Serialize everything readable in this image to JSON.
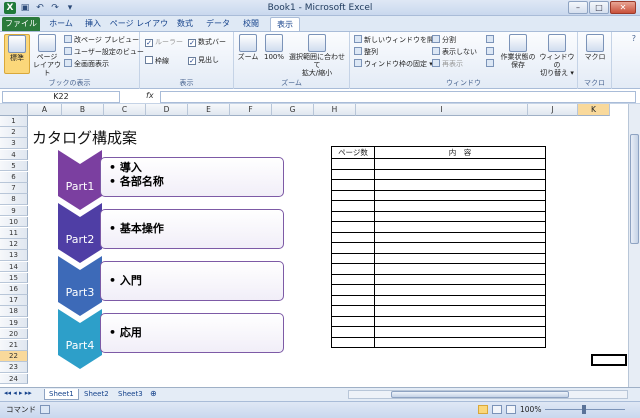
{
  "window": {
    "title": "Book1 - Microsoft Excel"
  },
  "tabs": [
    "ファイル",
    "ホーム",
    "挿入",
    "ページ レイアウト",
    "数式",
    "データ",
    "校閲",
    "表示"
  ],
  "ribbon": {
    "workbook_views": {
      "normal": "標準",
      "page_layout": "ページ\nレイアウト",
      "page_break": "改ページ プレビュー",
      "custom_views": "ユーザー設定のビュー",
      "full_screen": "全画面表示",
      "group": "ブックの表示"
    },
    "show": {
      "ruler": "ルーラー",
      "formula_bar": "数式バー",
      "gridlines": "枠線",
      "headings": "見出し",
      "group": "表示"
    },
    "zoom": {
      "zoom": "ズーム",
      "hundred": "100%",
      "to_selection": "選択範囲に合わせて\n拡大/縮小",
      "group": "ズーム"
    },
    "window": {
      "new_window": "新しいウィンドウを開く",
      "arrange": "整列",
      "freeze": "ウィンドウ枠の固定",
      "split": "分割",
      "hide": "表示しない",
      "unhide": "再表示",
      "save_ws": "作業状態の\n保存",
      "switch": "ウィンドウの\n切り替え",
      "group": "ウィンドウ"
    },
    "macros": {
      "label": "マクロ",
      "group": "マクロ"
    }
  },
  "formula_bar": {
    "name_box": "K22",
    "fx": "fx",
    "value": ""
  },
  "columns": [
    "A",
    "B",
    "C",
    "D",
    "E",
    "F",
    "G",
    "H",
    "I",
    "J",
    "K"
  ],
  "rows": [
    "1",
    "2",
    "3",
    "4",
    "5",
    "6",
    "7",
    "8",
    "9",
    "10",
    "11",
    "12",
    "13",
    "14",
    "15",
    "16",
    "17",
    "18",
    "19",
    "20",
    "21",
    "22",
    "23",
    "24"
  ],
  "sheet": {
    "title": "カタログ構成案",
    "parts": [
      {
        "label": "Part1",
        "bullets": [
          "導入",
          "各部名称"
        ]
      },
      {
        "label": "Part2",
        "bullets": [
          "基本操作"
        ]
      },
      {
        "label": "Part3",
        "bullets": [
          "入門"
        ]
      },
      {
        "label": "Part4",
        "bullets": [
          "応用"
        ]
      }
    ],
    "table_headers": [
      "ページ数",
      "内　容"
    ]
  },
  "sheet_tabs": [
    "Sheet1",
    "Sheet2",
    "Sheet3"
  ],
  "status": {
    "mode": "コマンド",
    "zoom": "100%"
  },
  "colors": {
    "chev1": "#7b3fa0",
    "chev2": "#4f3ea5",
    "chev3": "#3d6ab8",
    "chev4": "#2d9fc9"
  }
}
